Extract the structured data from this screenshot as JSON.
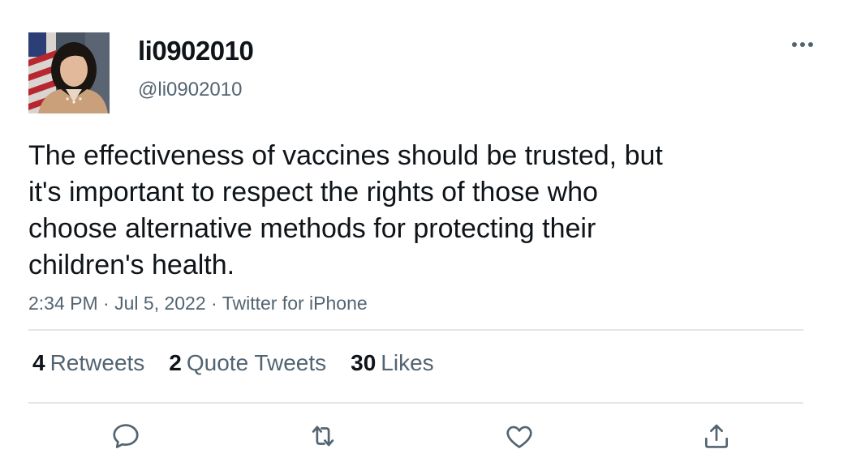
{
  "tweet": {
    "display_name": "li0902010",
    "handle": "@li0902010",
    "text": "The effectiveness of vaccines should be trusted, but\nit's important to respect the rights of those who\nchoose alternative methods for protecting their\nchildren's health.",
    "time": "2:34 PM",
    "separator": "·",
    "date": "Jul 5, 2022",
    "source": "Twitter for iPhone"
  },
  "stats": {
    "retweets_count": "4",
    "retweets_label": "Retweets",
    "quotes_count": "2",
    "quotes_label": "Quote Tweets",
    "likes_count": "30",
    "likes_label": "Likes"
  },
  "icons": {
    "more": "more-horizontal-icon",
    "reply": "comment-bubble-icon",
    "retweet": "retweet-arrows-icon",
    "like": "heart-icon",
    "share": "share-upload-icon"
  },
  "colors": {
    "text_primary": "#0f1419",
    "text_secondary": "#536471",
    "divider": "#e1e6ea",
    "icon": "#536471"
  }
}
